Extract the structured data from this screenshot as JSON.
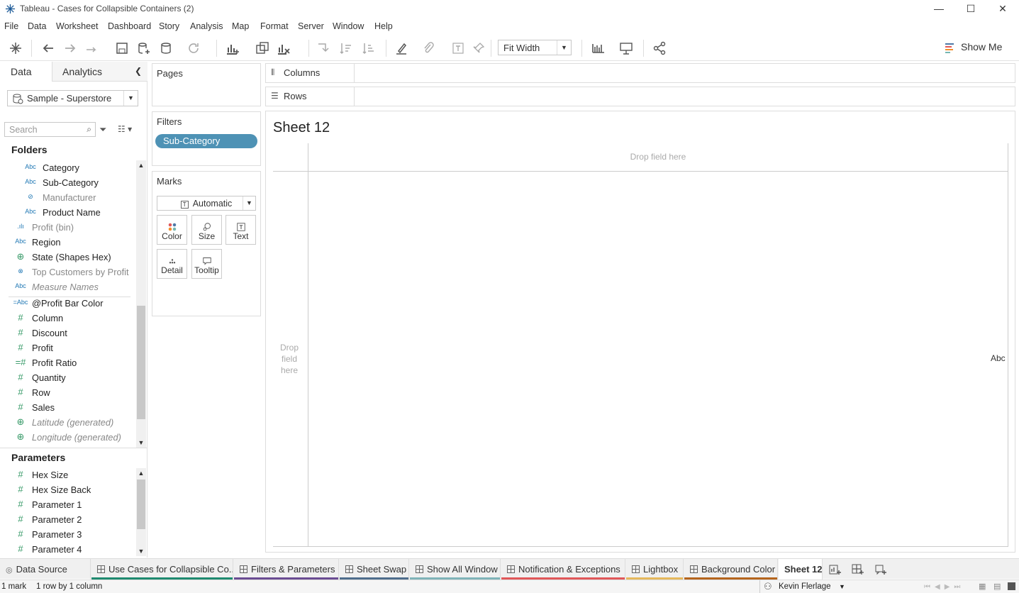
{
  "window": {
    "title": "Tableau - Cases for Collapsible Containers (2)",
    "minimize": "—",
    "maximize": "☐",
    "close": "✕"
  },
  "menu": [
    "File",
    "Data",
    "Worksheet",
    "Dashboard",
    "Story",
    "Analysis",
    "Map",
    "Format",
    "Server",
    "Window",
    "Help"
  ],
  "toolbar": {
    "fit": "Fit Width",
    "show_me": "Show Me"
  },
  "left_panel": {
    "tabs": {
      "data": "Data",
      "analytics": "Analytics"
    },
    "datasource": "Sample - Superstore",
    "search_placeholder": "Search",
    "folders_header": "Folders",
    "fields": [
      {
        "type": "Abc",
        "name": "Category",
        "style": "sub"
      },
      {
        "type": "Abc",
        "name": "Sub-Category",
        "style": "sub"
      },
      {
        "type": "clip",
        "name": "Manufacturer",
        "style": "sub dim"
      },
      {
        "type": "Abc",
        "name": "Product Name",
        "style": "sub"
      },
      {
        "type": "bin",
        "name": "Profit (bin)",
        "style": "dim"
      },
      {
        "type": "Abc",
        "name": "Region",
        "style": ""
      },
      {
        "type": "globe",
        "name": "State (Shapes Hex)",
        "style": ""
      },
      {
        "type": "set",
        "name": "Top Customers by Profit",
        "style": "dim"
      },
      {
        "type": "Abc",
        "name": "Measure Names",
        "style": "it"
      },
      {
        "type": "=Abc",
        "name": "@Profit Bar Color",
        "style": ""
      },
      {
        "type": "#",
        "name": "Column",
        "style": ""
      },
      {
        "type": "#",
        "name": "Discount",
        "style": ""
      },
      {
        "type": "#",
        "name": "Profit",
        "style": ""
      },
      {
        "type": "=#",
        "name": "Profit Ratio",
        "style": ""
      },
      {
        "type": "#",
        "name": "Quantity",
        "style": ""
      },
      {
        "type": "#",
        "name": "Row",
        "style": ""
      },
      {
        "type": "#",
        "name": "Sales",
        "style": ""
      },
      {
        "type": "globe",
        "name": "Latitude (generated)",
        "style": "it"
      },
      {
        "type": "globe",
        "name": "Longitude (generated)",
        "style": "it"
      }
    ],
    "parameters_header": "Parameters",
    "parameters": [
      "Hex Size",
      "Hex Size Back",
      "Parameter 1",
      "Parameter 2",
      "Parameter 3",
      "Parameter 4"
    ]
  },
  "cards": {
    "pages": "Pages",
    "filters": "Filters",
    "filter_pill": "Sub-Category",
    "marks": "Marks",
    "mark_type": "Automatic",
    "mark_buttons": [
      {
        "label": "Color",
        "icon": "color-icon"
      },
      {
        "label": "Size",
        "icon": "size-icon"
      },
      {
        "label": "Text",
        "icon": "text-icon"
      },
      {
        "label": "Detail",
        "icon": "detail-icon"
      },
      {
        "label": "Tooltip",
        "icon": "tooltip-icon"
      }
    ]
  },
  "shelves": {
    "columns": "Columns",
    "rows": "Rows"
  },
  "view": {
    "title": "Sheet 12",
    "drop_top": "Drop field here",
    "drop_left": "Drop field here",
    "mark_text": "Abc"
  },
  "sheet_tabs": [
    {
      "label": "Data Source",
      "color": "#f0f0f0",
      "type": "ds"
    },
    {
      "label": "Use Cases for Collapsible Co...",
      "color": "#1f8a70",
      "type": "dash"
    },
    {
      "label": "Filters & Parameters",
      "color": "#6a4c93",
      "type": "dash"
    },
    {
      "label": "Sheet Swap",
      "color": "#4e6d8c",
      "type": "dash"
    },
    {
      "label": "Show All Window",
      "color": "#7fb3b8",
      "type": "dash"
    },
    {
      "label": "Notification & Exceptions",
      "color": "#e15759",
      "type": "dash"
    },
    {
      "label": "Lightbox",
      "color": "#e5b85c",
      "type": "dash"
    },
    {
      "label": "Background Color",
      "color": "#b5651d",
      "type": "dash"
    },
    {
      "label": "Sheet 12",
      "color": "#ffffff",
      "type": "active"
    }
  ],
  "status": {
    "marks": "1 mark",
    "dims": "1 row by 1 column",
    "user": "Kevin Flerlage"
  }
}
